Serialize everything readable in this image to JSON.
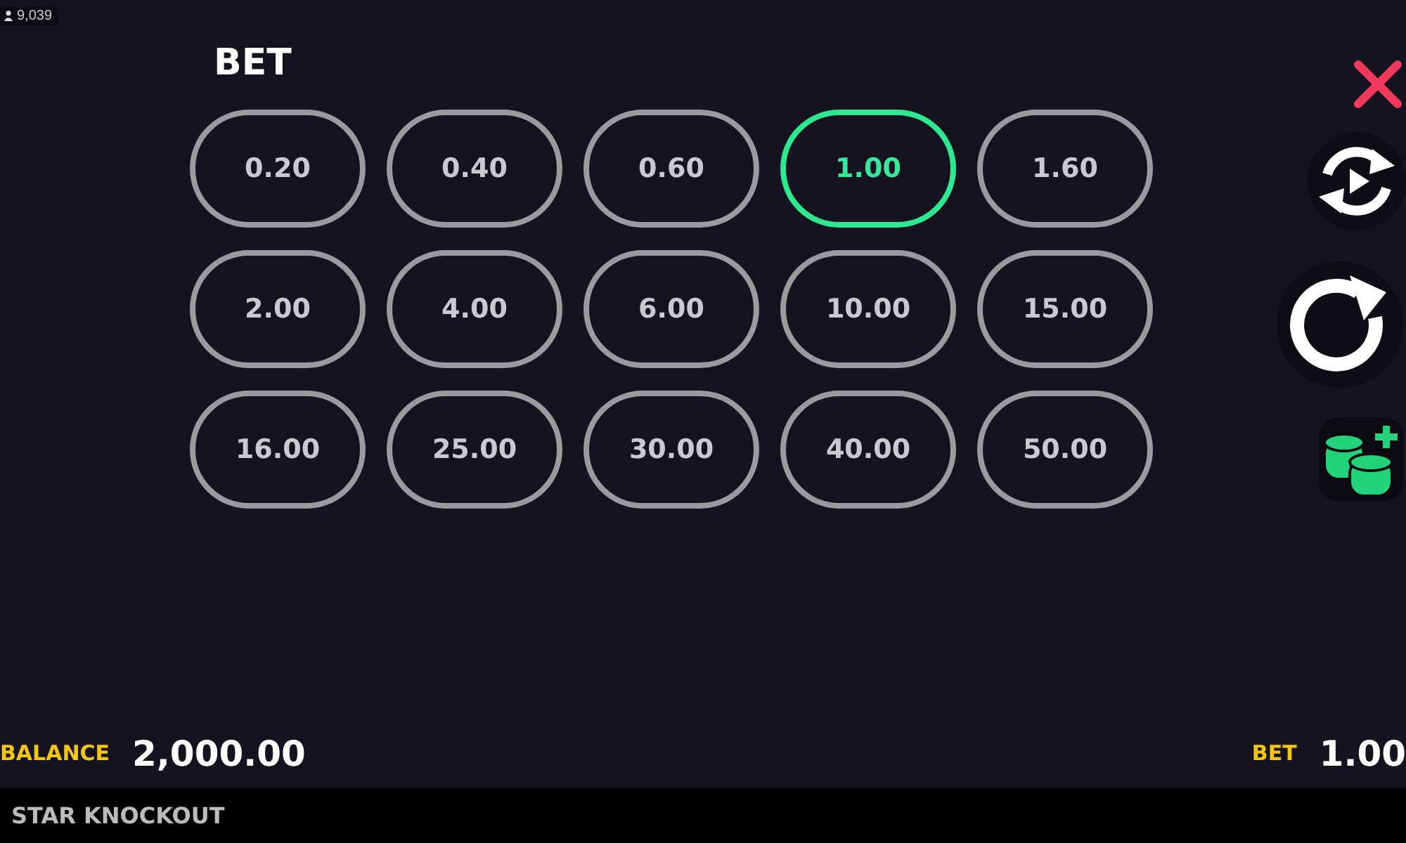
{
  "player_count": "9,039",
  "title": "BET",
  "bets": [
    {
      "label": "0.20",
      "selected": false
    },
    {
      "label": "0.40",
      "selected": false
    },
    {
      "label": "0.60",
      "selected": false
    },
    {
      "label": "1.00",
      "selected": true
    },
    {
      "label": "1.60",
      "selected": false
    },
    {
      "label": "2.00",
      "selected": false
    },
    {
      "label": "4.00",
      "selected": false
    },
    {
      "label": "6.00",
      "selected": false
    },
    {
      "label": "10.00",
      "selected": false
    },
    {
      "label": "15.00",
      "selected": false
    },
    {
      "label": "16.00",
      "selected": false
    },
    {
      "label": "25.00",
      "selected": false
    },
    {
      "label": "30.00",
      "selected": false
    },
    {
      "label": "40.00",
      "selected": false
    },
    {
      "label": "50.00",
      "selected": false
    }
  ],
  "balance": {
    "label": "BALANCE",
    "value": "2,000.00"
  },
  "bet": {
    "label": "BET",
    "value": "1.00"
  },
  "game_name": "STAR KNOCKOUT"
}
